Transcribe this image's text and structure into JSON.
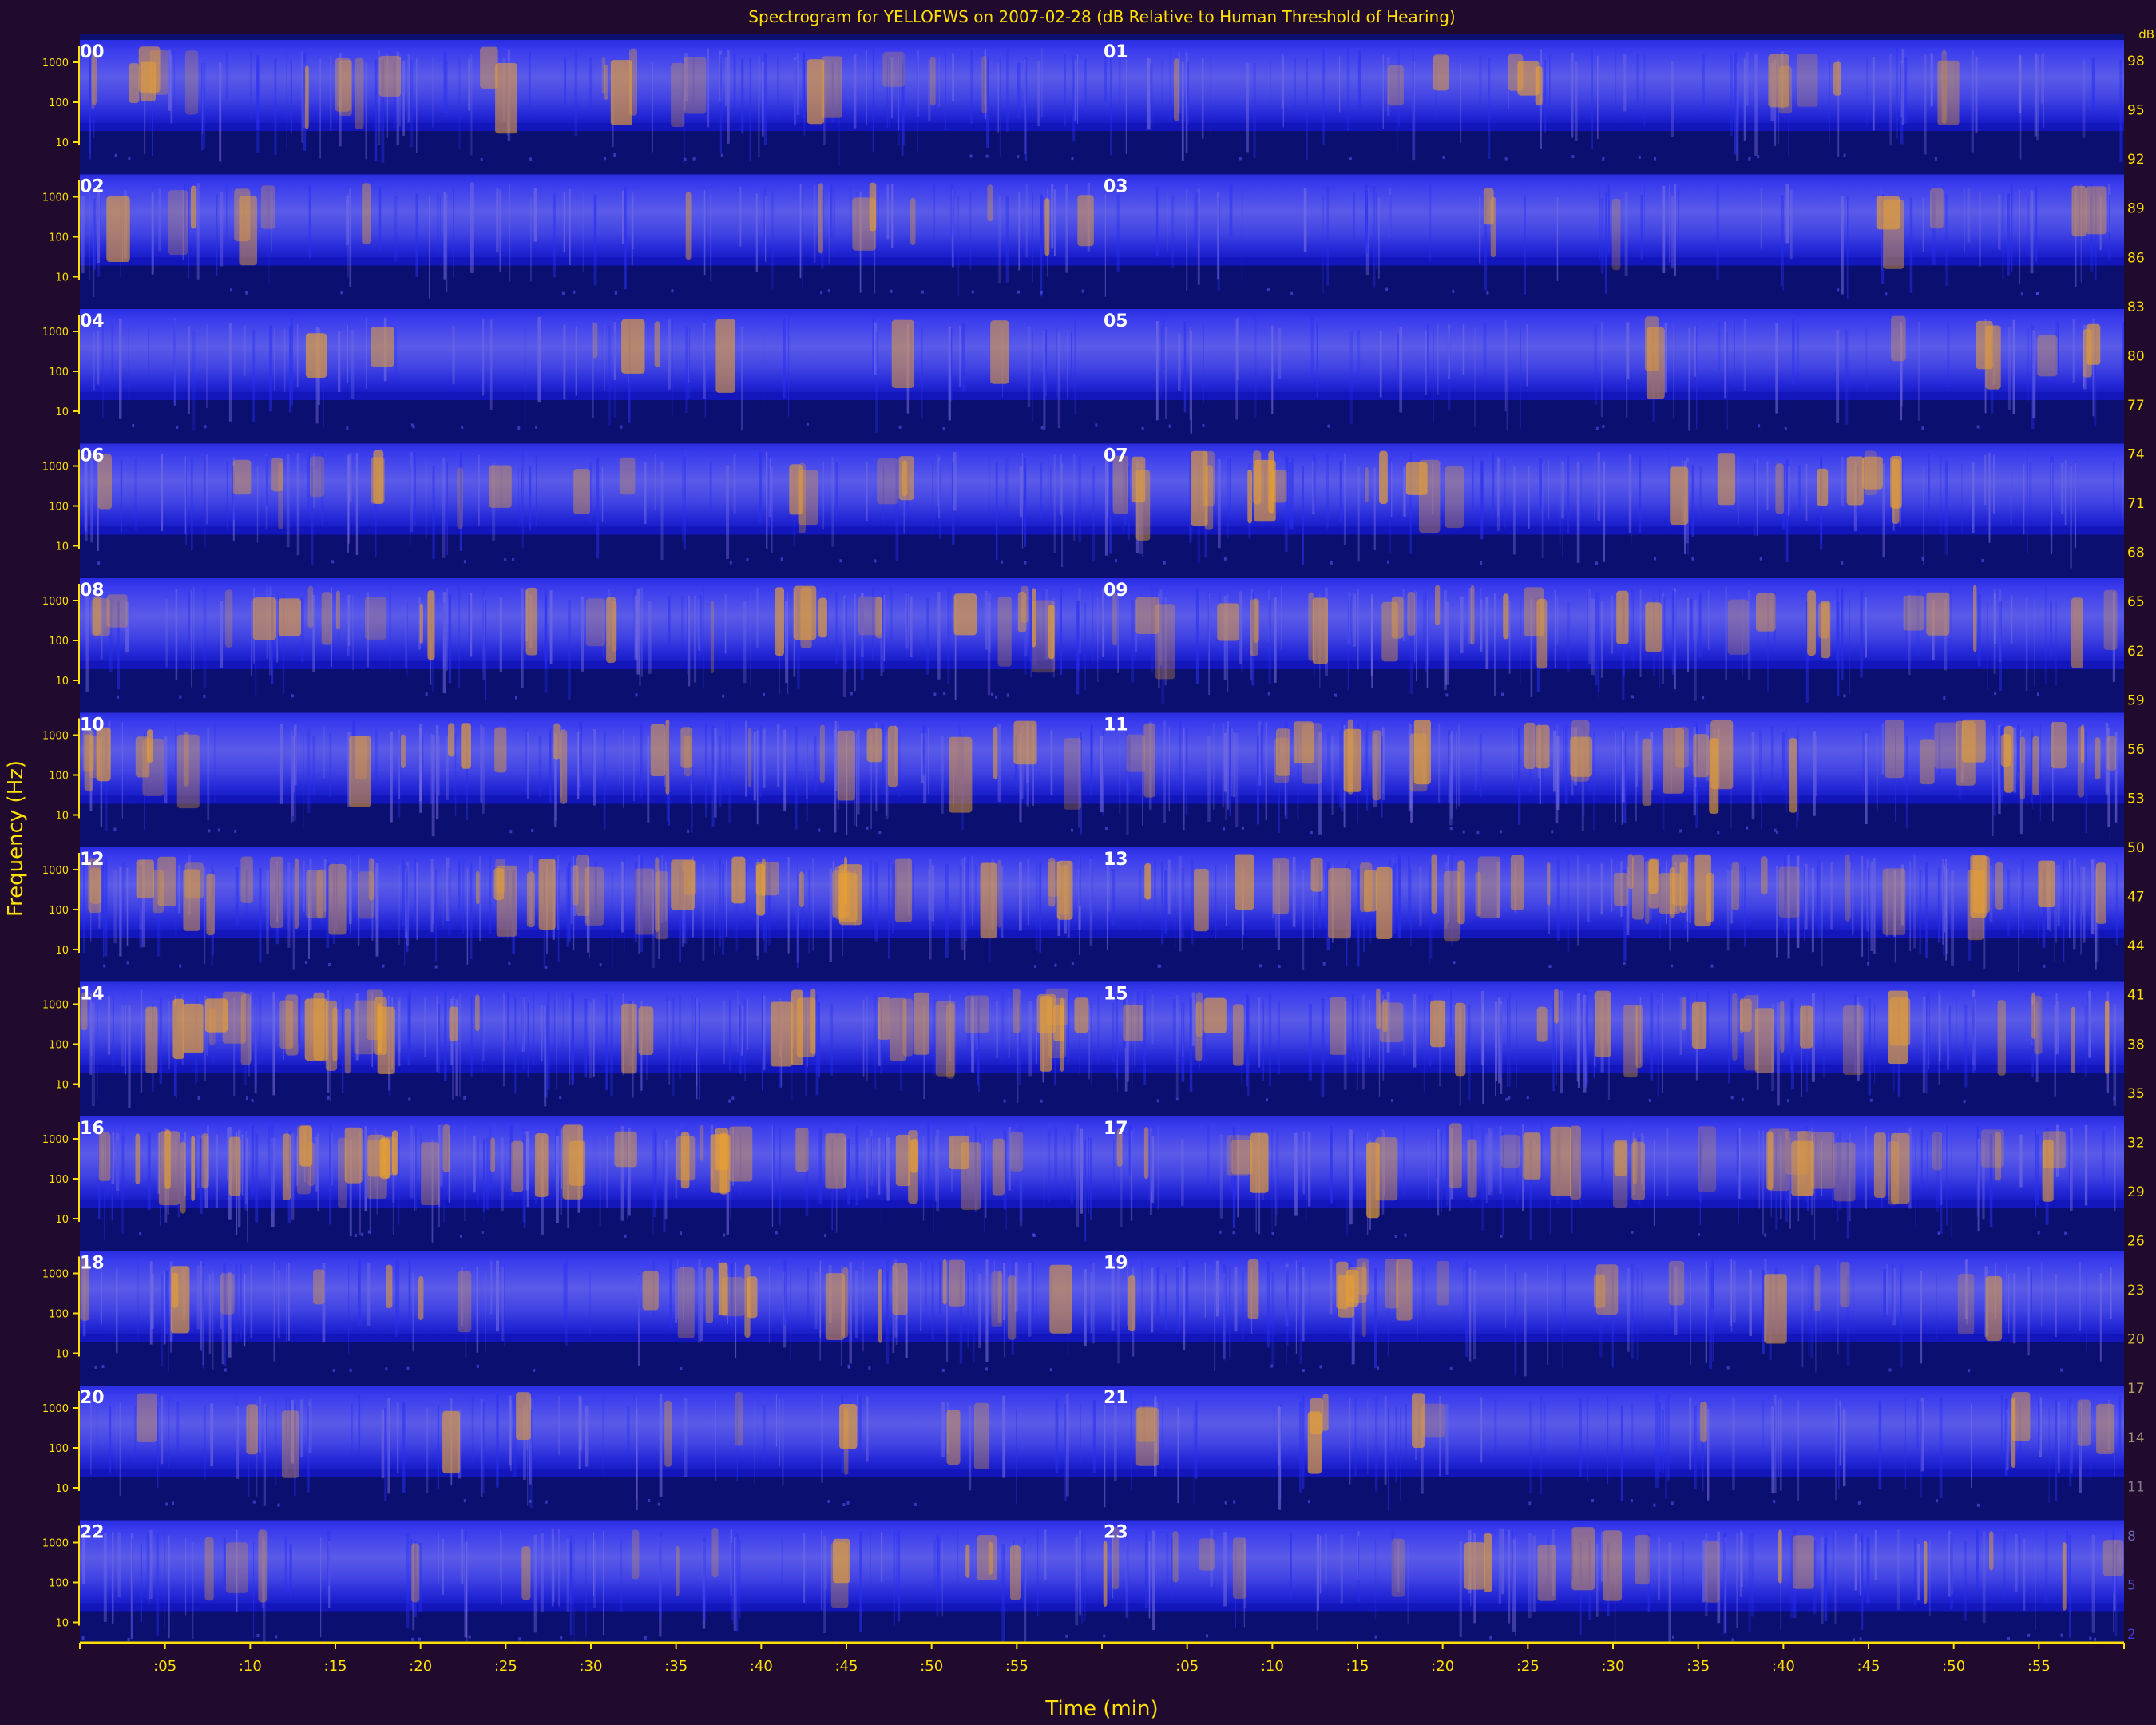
{
  "chart_data": {
    "type": "heatmap",
    "title": "Spectrogram for YELLOFWS on 2007-02-28 (dB Relative to Human Threshold of Hearing)",
    "xlabel": "Time (min)",
    "ylabel": "Frequency (Hz)",
    "x_tick_labels": [
      ":05",
      ":10",
      ":15",
      ":20",
      ":25",
      ":30",
      ":35",
      ":40",
      ":45",
      ":50",
      ":55"
    ],
    "y_tick_labels": [
      "1000",
      "100",
      "10"
    ],
    "hours": [
      "00",
      "01",
      "02",
      "03",
      "04",
      "05",
      "06",
      "07",
      "08",
      "09",
      "10",
      "11",
      "12",
      "13",
      "14",
      "15",
      "16",
      "17",
      "18",
      "19",
      "20",
      "21",
      "22",
      "23"
    ],
    "colorbar_ticks": [
      98,
      95,
      92,
      89,
      86,
      83,
      80,
      77,
      74,
      71,
      68,
      65,
      62,
      59,
      56,
      53,
      50,
      47,
      44,
      41,
      38,
      35,
      32,
      29,
      26,
      23,
      20,
      17,
      14,
      11,
      8,
      5,
      2
    ],
    "colorbar_unit": "dB",
    "activity_level": [
      0.45,
      0.22,
      0.28,
      0.14,
      0.14,
      0.14,
      0.3,
      0.45,
      0.55,
      0.5,
      0.55,
      0.65,
      0.85,
      0.7,
      0.78,
      0.6,
      0.8,
      0.6,
      0.45,
      0.35,
      0.2,
      0.22,
      0.25,
      0.35
    ],
    "colors": {
      "background": "#200a2e",
      "empty": "#0b0f70",
      "band": "#2b2fd8",
      "edge": "#1418c8",
      "event": "#e8a030",
      "axis": "#ffe000",
      "text": "#ffffff"
    }
  }
}
